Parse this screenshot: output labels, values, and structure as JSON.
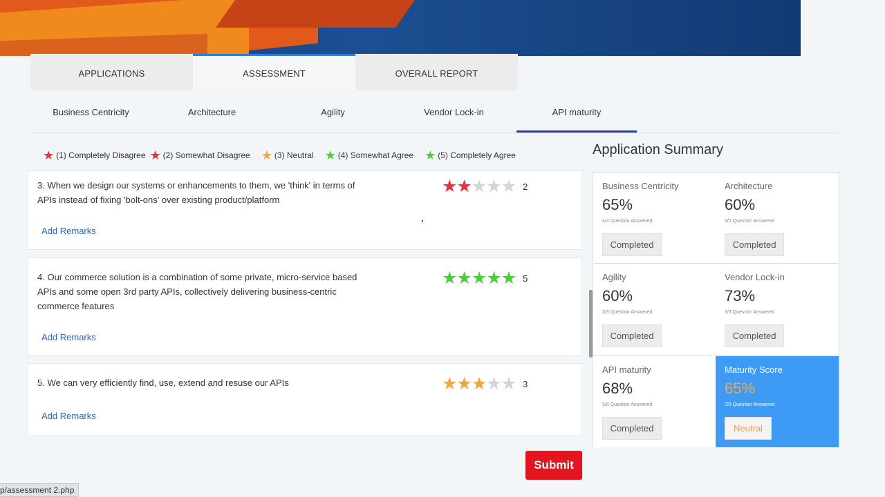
{
  "tabs": [
    "APPLICATIONS",
    "ASSESSMENT",
    "OVERALL REPORT"
  ],
  "active_tab": "ASSESSMENT",
  "subtabs": [
    "Business Centricity",
    "Architecture",
    "Agility",
    "Vendor Lock-in",
    "API maturity"
  ],
  "active_subtab": "API maturity",
  "legend": [
    {
      "label": "(1) Completely Disagree",
      "color": "#e8333b"
    },
    {
      "label": "(2) Somewhat Disagree",
      "color": "#e8333b"
    },
    {
      "label": "(3) Neutral",
      "color": "#f5a43a"
    },
    {
      "label": "(4) Somewhat Agree",
      "color": "#4ccd3a"
    },
    {
      "label": "(5) Completely Agree",
      "color": "#4ccd3a"
    }
  ],
  "questions": [
    {
      "text": "3. When we design our systems or enhancements to them, we 'think' in terms of APIs instead of fixing 'bolt-ons' over existing product/platform",
      "rating": 2,
      "rating_label": "2",
      "color": "#e8333b",
      "remarks": "Add Remarks"
    },
    {
      "text": "4. Our commerce solution is a combination of some private, micro-service based APIs and some open 3rd party APIs, collectively delivering business-centric commerce features",
      "rating": 5,
      "rating_label": "5",
      "color": "#4ccd3a",
      "remarks": "Add Remarks"
    },
    {
      "text": "5. We can very efficiently find, use, extend and resuse our APIs",
      "rating": 3,
      "rating_label": "3",
      "color": "#f5a43a",
      "remarks": "Add Remarks"
    }
  ],
  "star_empty_color": "#d4d4d4",
  "summary": {
    "title": "Application Summary",
    "cells": [
      {
        "name": "Business Centricity",
        "percent": "65%",
        "answered": "4/4 Question Answered",
        "status": "Completed"
      },
      {
        "name": "Architecture",
        "percent": "60%",
        "answered": "5/5 Question Answered",
        "status": "Completed"
      },
      {
        "name": "Agility",
        "percent": "60%",
        "answered": "3/3 Question Answered",
        "status": "Completed"
      },
      {
        "name": "Vendor Lock-in",
        "percent": "73%",
        "answered": "3/3 Question Answered",
        "status": "Completed"
      },
      {
        "name": "API maturity",
        "percent": "68%",
        "answered": "5/5 Question Answered",
        "status": "Completed"
      },
      {
        "name": "Maturity Score",
        "percent": "65%",
        "answered": "/20 Question Answered",
        "status": "Neutral"
      }
    ]
  },
  "submit_label": "Submit",
  "status_url": "p/assessment 2.php"
}
